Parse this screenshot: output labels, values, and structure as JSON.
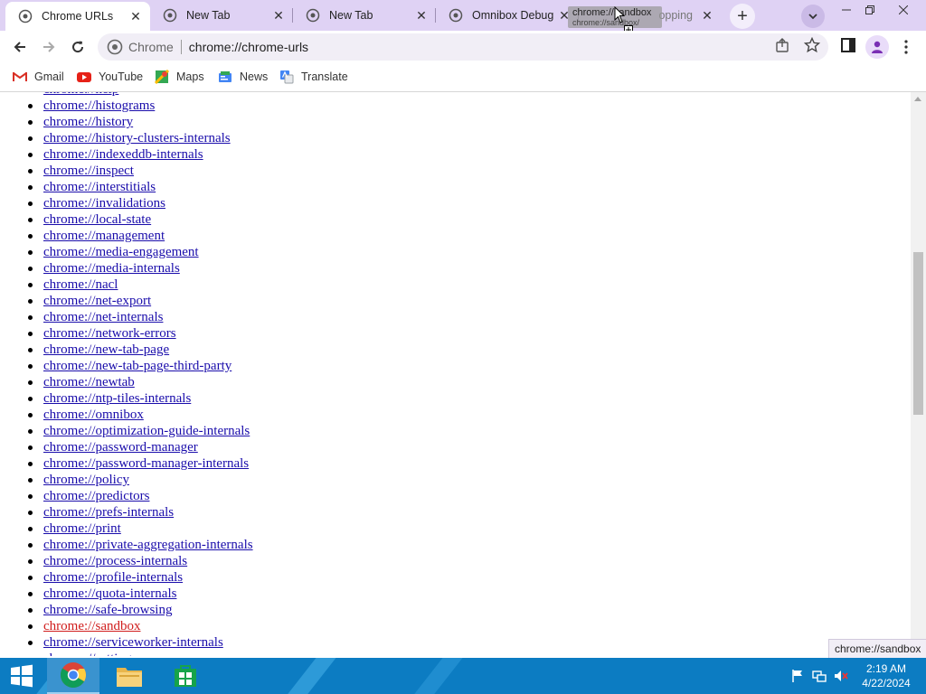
{
  "tabs": [
    {
      "title": "Chrome URLs",
      "active": true
    },
    {
      "title": "New Tab",
      "active": false
    },
    {
      "title": "New Tab",
      "active": false
    },
    {
      "title": "Omnibox Debug",
      "active": false
    },
    {
      "title": "opping",
      "active": false
    }
  ],
  "drag_ghost": {
    "title": "chrome://sandbox",
    "subtitle": "chrome://sandbox/"
  },
  "new_tab_label": "+",
  "toolbar": {
    "site_chip": "Chrome",
    "url": "chrome://chrome-urls"
  },
  "bookmarks": [
    {
      "label": "Gmail",
      "icon": "gmail-icon"
    },
    {
      "label": "YouTube",
      "icon": "youtube-icon"
    },
    {
      "label": "Maps",
      "icon": "maps-icon"
    },
    {
      "label": "News",
      "icon": "news-icon"
    },
    {
      "label": "Translate",
      "icon": "translate-icon"
    }
  ],
  "links": [
    "chrome://help",
    "chrome://histograms",
    "chrome://history",
    "chrome://history-clusters-internals",
    "chrome://indexeddb-internals",
    "chrome://inspect",
    "chrome://interstitials",
    "chrome://invalidations",
    "chrome://local-state",
    "chrome://management",
    "chrome://media-engagement",
    "chrome://media-internals",
    "chrome://nacl",
    "chrome://net-export",
    "chrome://net-internals",
    "chrome://network-errors",
    "chrome://new-tab-page",
    "chrome://new-tab-page-third-party",
    "chrome://newtab",
    "chrome://ntp-tiles-internals",
    "chrome://omnibox",
    "chrome://optimization-guide-internals",
    "chrome://password-manager",
    "chrome://password-manager-internals",
    "chrome://policy",
    "chrome://predictors",
    "chrome://prefs-internals",
    "chrome://print",
    "chrome://private-aggregation-internals",
    "chrome://process-internals",
    "chrome://profile-internals",
    "chrome://quota-internals",
    "chrome://safe-browsing",
    "chrome://sandbox",
    "chrome://serviceworker-internals",
    "chrome://settings"
  ],
  "active_link": "chrome://sandbox",
  "status_bubble": "chrome://sandbox",
  "clock": {
    "time": "2:19 AM",
    "date": "4/22/2024"
  },
  "colors": {
    "tabstrip": "#dfd2f4",
    "link": "#1a0dab",
    "link_active": "#d01c1c",
    "taskbar": "#0c7cc2"
  }
}
